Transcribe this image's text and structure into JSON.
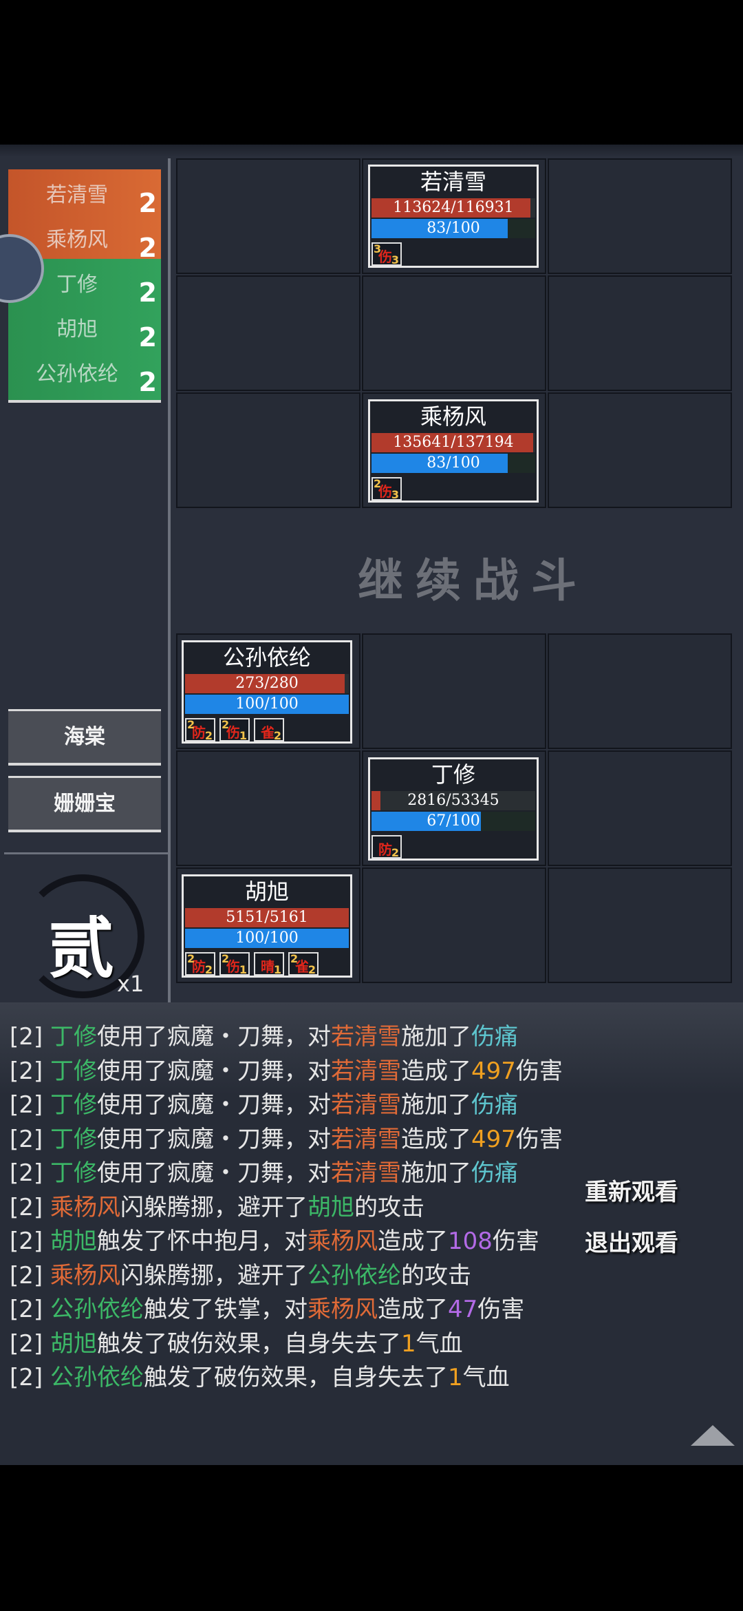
{
  "turn_order": [
    {
      "name": "若清雪",
      "count": "2",
      "side": "enemy"
    },
    {
      "name": "乘杨风",
      "count": "2",
      "side": "enemy"
    },
    {
      "name": "丁修",
      "count": "2",
      "side": "ally"
    },
    {
      "name": "胡旭",
      "count": "2",
      "side": "ally"
    },
    {
      "name": "公孙依纶",
      "count": "2",
      "side": "ally"
    }
  ],
  "reserves": [
    "海棠",
    "姗姗宝"
  ],
  "round": {
    "label": "贰",
    "multiplier": "x1"
  },
  "center_text": "继续战斗",
  "units": [
    {
      "name": "若清雪",
      "hp": "113624/116931",
      "hp_ratio": 0.972,
      "mp": "83/100",
      "mp_ratio": 0.83,
      "statuses": [
        {
          "label": "伤",
          "stack": "3",
          "turns": "3"
        }
      ]
    },
    {
      "name": "乘杨风",
      "hp": "135641/137194",
      "hp_ratio": 0.989,
      "mp": "83/100",
      "mp_ratio": 0.83,
      "statuses": [
        {
          "label": "伤",
          "stack": "2",
          "turns": "3"
        }
      ]
    },
    {
      "name": "公孙依纶",
      "hp": "273/280",
      "hp_ratio": 0.975,
      "mp": "100/100",
      "mp_ratio": 1.0,
      "statuses": [
        {
          "label": "防",
          "stack": "2",
          "turns": "2"
        },
        {
          "label": "伤",
          "stack": "2",
          "turns": "1"
        },
        {
          "label": "雀",
          "stack": "",
          "turns": "2"
        }
      ]
    },
    {
      "name": "丁修",
      "hp": "2816/53345",
      "hp_ratio": 0.053,
      "mp": "67/100",
      "mp_ratio": 0.67,
      "statuses": [
        {
          "label": "防",
          "stack": "",
          "turns": "2"
        }
      ]
    },
    {
      "name": "胡旭",
      "hp": "5151/5161",
      "hp_ratio": 0.998,
      "mp": "100/100",
      "mp_ratio": 1.0,
      "statuses": [
        {
          "label": "防",
          "stack": "2",
          "turns": "2"
        },
        {
          "label": "伤",
          "stack": "2",
          "turns": "1"
        },
        {
          "label": "晴",
          "stack": "",
          "turns": "1"
        },
        {
          "label": "雀",
          "stack": "2",
          "turns": "2"
        }
      ]
    }
  ],
  "log": [
    [
      [
        "[2] ",
        ""
      ],
      [
        "丁修",
        "c-ally"
      ],
      [
        "使用了疯魔・刀舞，对",
        ""
      ],
      [
        "若清雪",
        "c-enemy"
      ],
      [
        "施加了",
        ""
      ],
      [
        "伤痛",
        "c-debuff"
      ]
    ],
    [
      [
        "[2] ",
        ""
      ],
      [
        "丁修",
        "c-ally"
      ],
      [
        "使用了疯魔・刀舞，对",
        ""
      ],
      [
        "若清雪",
        "c-enemy"
      ],
      [
        "造成了",
        ""
      ],
      [
        "497",
        "c-num"
      ],
      [
        "伤害",
        ""
      ]
    ],
    [
      [
        "[2] ",
        ""
      ],
      [
        "丁修",
        "c-ally"
      ],
      [
        "使用了疯魔・刀舞，对",
        ""
      ],
      [
        "若清雪",
        "c-enemy"
      ],
      [
        "施加了",
        ""
      ],
      [
        "伤痛",
        "c-debuff"
      ]
    ],
    [
      [
        "[2] ",
        ""
      ],
      [
        "丁修",
        "c-ally"
      ],
      [
        "使用了疯魔・刀舞，对",
        ""
      ],
      [
        "若清雪",
        "c-enemy"
      ],
      [
        "造成了",
        ""
      ],
      [
        "497",
        "c-num"
      ],
      [
        "伤害",
        ""
      ]
    ],
    [
      [
        "[2] ",
        ""
      ],
      [
        "丁修",
        "c-ally"
      ],
      [
        "使用了疯魔・刀舞，对",
        ""
      ],
      [
        "若清雪",
        "c-enemy"
      ],
      [
        "施加了",
        ""
      ],
      [
        "伤痛",
        "c-debuff"
      ]
    ],
    [
      [
        "[2] ",
        ""
      ],
      [
        "乘杨风",
        "c-enemy"
      ],
      [
        "闪躲腾挪，避开了",
        ""
      ],
      [
        "胡旭",
        "c-ally"
      ],
      [
        "的攻击",
        ""
      ]
    ],
    [
      [
        "[2] ",
        ""
      ],
      [
        "胡旭",
        "c-ally"
      ],
      [
        "触发了怀中抱月，对",
        ""
      ],
      [
        "乘杨风",
        "c-enemy"
      ],
      [
        "造成了",
        ""
      ],
      [
        "108",
        "c-purple"
      ],
      [
        "伤害",
        ""
      ]
    ],
    [
      [
        "[2] ",
        ""
      ],
      [
        "乘杨风",
        "c-enemy"
      ],
      [
        "闪躲腾挪，避开了",
        ""
      ],
      [
        "公孙依纶",
        "c-ally"
      ],
      [
        "的攻击",
        ""
      ]
    ],
    [
      [
        "[2] ",
        ""
      ],
      [
        "公孙依纶",
        "c-ally"
      ],
      [
        "触发了铁掌，对",
        ""
      ],
      [
        "乘杨风",
        "c-enemy"
      ],
      [
        "造成了",
        ""
      ],
      [
        "47",
        "c-purple"
      ],
      [
        "伤害",
        ""
      ]
    ],
    [
      [
        "[2] ",
        ""
      ],
      [
        "胡旭",
        "c-ally"
      ],
      [
        "触发了破伤效果，自身失去了",
        ""
      ],
      [
        "1",
        "c-num"
      ],
      [
        "气血",
        ""
      ]
    ],
    [
      [
        "[2] ",
        ""
      ],
      [
        "公孙依纶",
        "c-ally"
      ],
      [
        "触发了破伤效果，自身失去了",
        ""
      ],
      [
        "1",
        "c-num"
      ],
      [
        "气血",
        ""
      ]
    ]
  ],
  "actions": {
    "replay": "重新观看",
    "exit": "退出观看"
  }
}
